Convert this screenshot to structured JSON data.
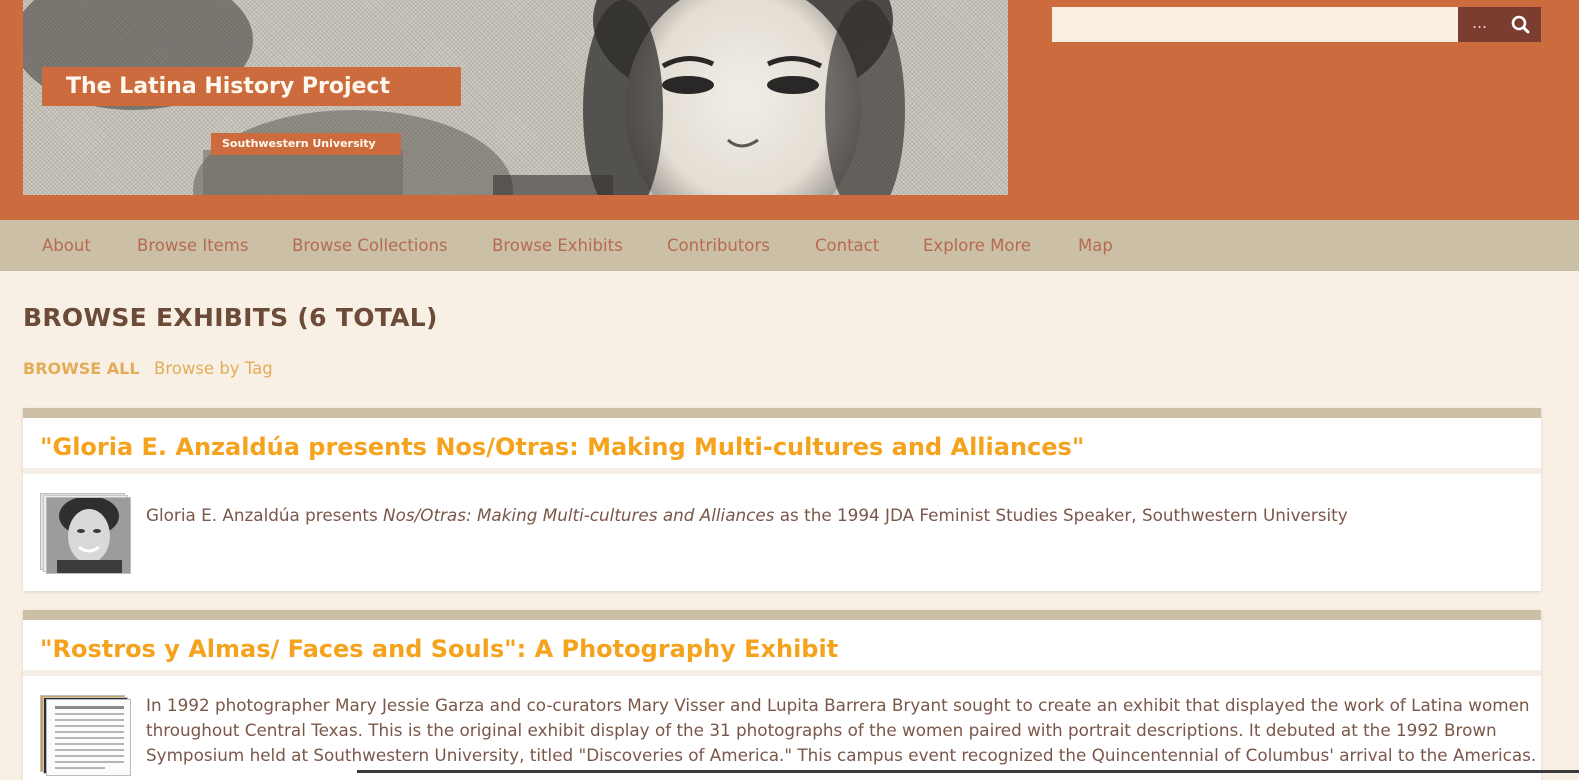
{
  "header": {
    "site_title": "The Latina History Project",
    "site_subtitle": "Southwestern University",
    "search": {
      "value": "",
      "options_label": "…"
    },
    "icons": {
      "search": "search-icon"
    }
  },
  "nav": {
    "items": [
      "About",
      "Browse Items",
      "Browse Collections",
      "Browse Exhibits",
      "Contributors",
      "Contact",
      "Explore More",
      "Map"
    ]
  },
  "main": {
    "title": "BROWSE EXHIBITS (6 TOTAL)",
    "filters": {
      "all": "BROWSE ALL",
      "by_tag": "Browse by Tag"
    },
    "exhibits": [
      {
        "title": "\"Gloria E. Anzaldúa presents Nos/Otras: Making Multi-cultures and Alliances\"",
        "desc_before": "Gloria E. Anzaldúa presents ",
        "desc_italic": "Nos/Otras: Making Multi-cultures and Alliances",
        "desc_after": " as the 1994 JDA Feminist Studies Speaker, Southwestern University"
      },
      {
        "title": "\"Rostros y Almas/ Faces and Souls\": A Photography Exhibit",
        "desc_line1": "In 1992 photographer Mary Jessie Garza and co-curators Mary Visser and Lupita Barrera Bryant sought to create an exhibit that displayed the work of Latina women",
        "desc_line2": "throughout Central Texas. This is the original exhibit display of the 31 photographs of the women paired with portrait descriptions. It debuted at the 1992 Brown",
        "desc_line3": "Symposium held at Southwestern University, titled \"Discoveries of America.\" This campus event recognized the Quincentennial of Columbus' arrival to the Americas."
      }
    ]
  },
  "colors": {
    "header_bg": "#cc6c3e",
    "nav_bg": "#cbbfa6",
    "page_bg": "#f8f0e4",
    "exhibit_title": "#f5a21d",
    "search_button": "#7c3d31"
  }
}
